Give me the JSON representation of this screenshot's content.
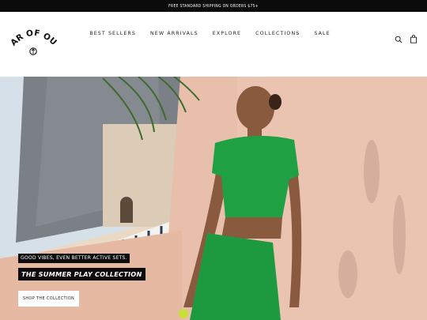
{
  "announcement": "FREE STANDARD SHIPPING ON ORDERS $75+",
  "brand": {
    "logo_text": "YEAR OF OURS"
  },
  "nav": [
    "BEST SELLERS",
    "NEW ARRIVALS",
    "EXPLORE",
    "COLLECTIONS",
    "SALE"
  ],
  "header_icons": [
    "search-icon",
    "shopping-bag-icon"
  ],
  "hero": {
    "tagline": "GOOD VIBES, EVEN BETTER ACTIVE SETS.",
    "title": "THE SUMMER PLAY COLLECTION",
    "cta_label": "SHOP THE COLLECTION"
  },
  "colors": {
    "announcement_bg": "#0b0b0b",
    "outfit_green": "#1fa043",
    "wall": "#e8bfaa"
  }
}
